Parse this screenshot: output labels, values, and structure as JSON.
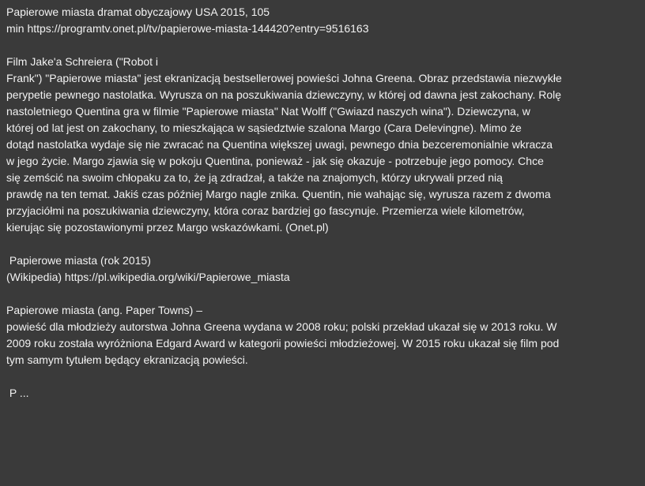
{
  "text": {
    "lines": [
      "Papierowe miasta dramat obyczajowy USA 2015, 105",
      "min https://programtv.onet.pl/tv/papierowe-miasta-144420?entry=9516163",
      "",
      "Film Jake'a Schreiera (\"Robot i",
      "Frank\") \"Papierowe miasta\" jest ekranizacją bestsellerowej powieści Johna Greena. Obraz przedstawia niezwykłe",
      "perypetie pewnego nastolatka. Wyrusza on na poszukiwania dziewczyny, w której od dawna jest zakochany. Rolę",
      "nastoletniego Quentina gra w filmie \"Papierowe miasta\" Nat Wolff (\"Gwiazd naszych wina\"). Dziewczyna, w",
      "której od lat jest on zakochany, to mieszkająca w sąsiedztwie szalona Margo (Cara Delevingne). Mimo że",
      "dotąd nastolatka wydaje się nie zwracać na Quentina większej uwagi, pewnego dnia bezceremonialnie wkracza",
      "w jego życie. Margo zjawia się w pokoju Quentina, ponieważ - jak się okazuje - potrzebuje jego pomocy. Chce",
      "się zemścić na swoim chłopaku za to, że ją zdradzał, a także na znajomych, którzy ukrywali przed nią",
      "prawdę na ten temat. Jakiś czas później Margo nagle znika. Quentin, nie wahając się, wyrusza razem z dwoma",
      "przyjaciółmi na poszukiwania dziewczyny, która coraz bardziej go fascynuje. Przemierza wiele kilometrów,",
      "kierując się pozostawionymi przez Margo wskazówkami. (Onet.pl)",
      "",
      " Papierowe miasta (rok 2015)",
      "(Wikipedia) https://pl.wikipedia.org/wiki/Papierowe_miasta",
      "",
      "Papierowe miasta (ang. Paper Towns) –",
      "powieść dla młodzieży autorstwa Johna Greena wydana w 2008 roku; polski przekład ukazał się w 2013 roku. W",
      "2009 roku została wyróżniona Edgard Award w kategorii powieści młodzieżowej. W 2015 roku ukazał się film pod",
      "tym samym tytułem będący ekranizacją powieści.",
      "",
      " P ..."
    ]
  },
  "colors": {
    "background": "#3a3a3a",
    "text": "#f2f2f2"
  }
}
